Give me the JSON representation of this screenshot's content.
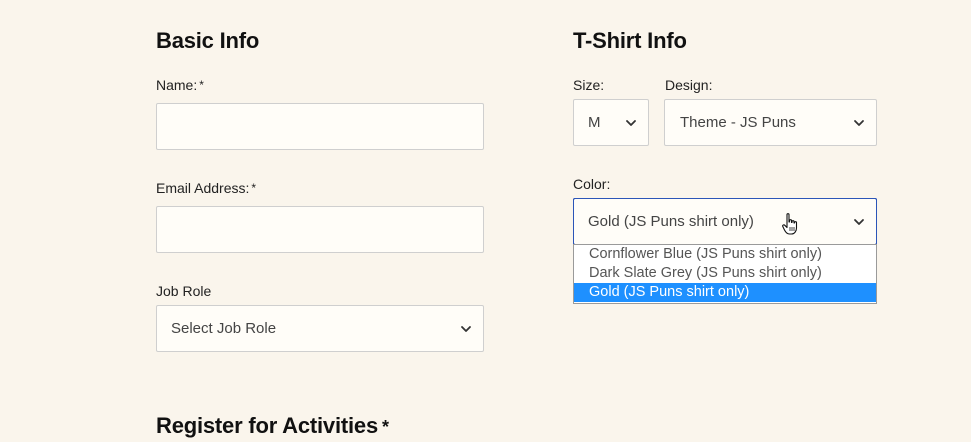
{
  "basic_info": {
    "heading": "Basic Info",
    "name_label": "Name:",
    "name_value": "",
    "email_label": "Email Address:",
    "email_value": "",
    "job_role_label": "Job Role",
    "job_role_selected": "Select Job Role",
    "required_mark": "*"
  },
  "tshirt_info": {
    "heading": "T-Shirt Info",
    "size_label": "Size:",
    "size_selected": "M",
    "design_label": "Design:",
    "design_selected": "Theme - JS Puns",
    "color_label": "Color:",
    "color_selected": "Gold (JS Puns shirt only)",
    "color_options": [
      {
        "label": "Cornflower Blue (JS Puns shirt only)",
        "selected": false
      },
      {
        "label": "Dark Slate Grey (JS Puns shirt only)",
        "selected": false
      },
      {
        "label": "Gold (JS Puns shirt only)",
        "selected": true
      }
    ]
  },
  "activities": {
    "heading": "Register for Activities",
    "required_mark": "*"
  },
  "icons": {
    "select_arrow": "chevron-down-icon",
    "cursor": "hand-pointer-icon"
  },
  "colors": {
    "background": "#faf5ec",
    "focus_border": "#2b55b8",
    "option_highlight": "#1e90ff"
  }
}
